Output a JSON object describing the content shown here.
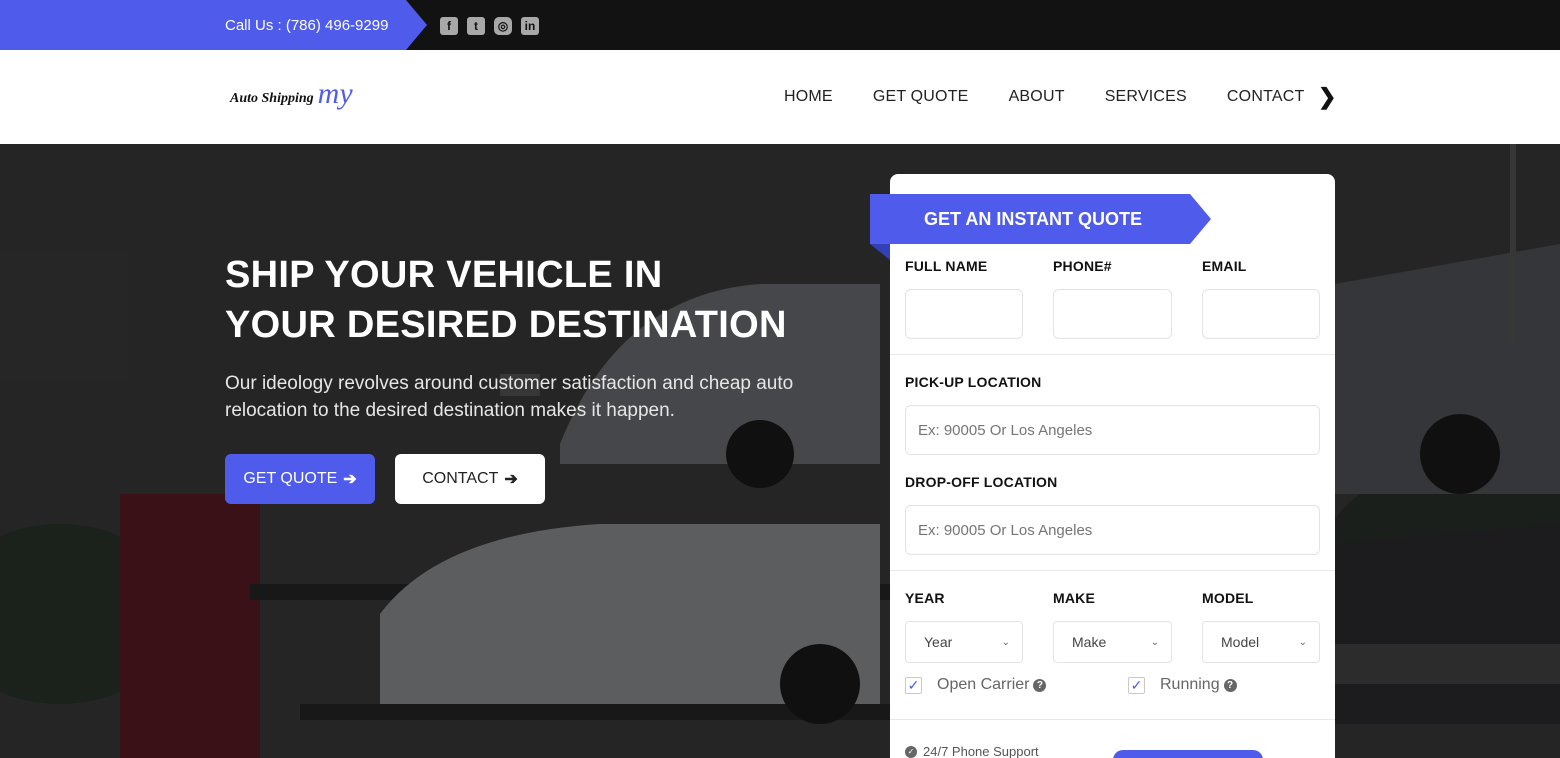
{
  "topbar": {
    "call_text": "Call Us : (786) 496-9299",
    "socials": [
      {
        "icon": "facebook-icon",
        "glyph": "f"
      },
      {
        "icon": "twitter-icon",
        "glyph": "t"
      },
      {
        "icon": "instagram-icon",
        "glyph": "◎"
      },
      {
        "icon": "linkedin-icon",
        "glyph": "in"
      }
    ]
  },
  "brand": {
    "text": "Auto Shipping",
    "mark": "my"
  },
  "nav": {
    "items": [
      "HOME",
      "GET QUOTE",
      "ABOUT",
      "SERVICES",
      "CONTACT"
    ],
    "more_icon": "chevron-right-icon"
  },
  "hero": {
    "title_line1": "SHIP YOUR VEHICLE IN",
    "title_line2": "YOUR DESIRED DESTINATION",
    "subtitle": "Our ideology revolves around customer satisfaction and cheap auto relocation to the desired destination makes it happen.",
    "quote_button": "GET QUOTE",
    "contact_button": "CONTACT"
  },
  "quote_form": {
    "ribbon": "GET AN INSTANT QUOTE",
    "full_name_label": "FULL NAME",
    "phone_label": "PHONE#",
    "email_label": "EMAIL",
    "pickup_label": "PICK-UP LOCATION",
    "pickup_placeholder": "Ex: 90005 Or Los Angeles",
    "dropoff_label": "DROP-OFF LOCATION",
    "dropoff_placeholder": "Ex: 90005 Or Los Angeles",
    "year_label": "YEAR",
    "make_label": "MAKE",
    "model_label": "MODEL",
    "year_value": "Year",
    "make_value": "Make",
    "model_value": "Model",
    "open_carrier_label": "Open Carrier",
    "running_label": "Running",
    "support_text": "24/7 Phone Support"
  },
  "colors": {
    "accent": "#4f5bea",
    "topbar": "#121212"
  }
}
